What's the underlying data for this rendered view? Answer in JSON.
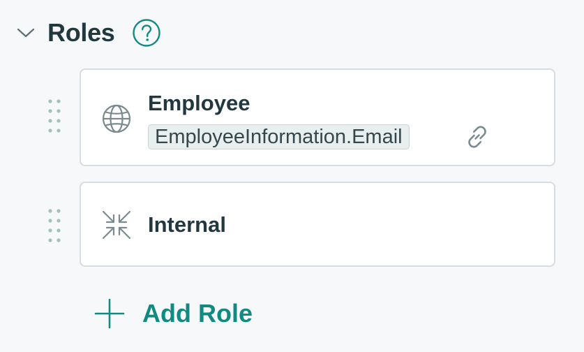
{
  "section": {
    "title": "Roles"
  },
  "roles": [
    {
      "name": "Employee",
      "icon": "globe-icon",
      "attribute": "EmployeeInformation.Email"
    },
    {
      "name": "Internal",
      "icon": "collapse-arrows-icon"
    }
  ],
  "actions": {
    "add_role_label": "Add Role"
  },
  "colors": {
    "accent": "#128a82",
    "text": "#22383f",
    "border": "#d5dde0",
    "background": "#f6f8f9",
    "icon_grey": "#7a8a8e",
    "drag_dots": "#9fc2bd"
  }
}
